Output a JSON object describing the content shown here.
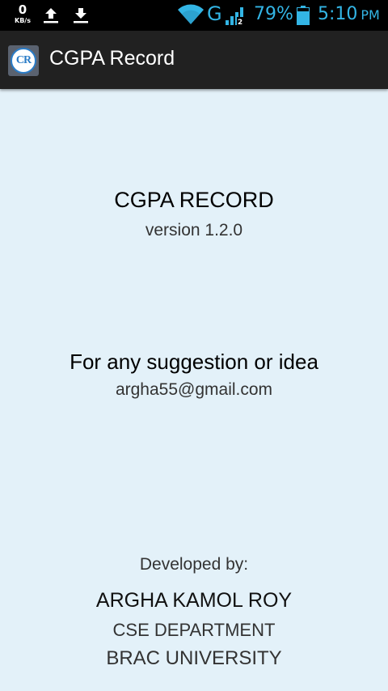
{
  "status_bar": {
    "net_speed_value": "0",
    "net_speed_unit": "KB/s",
    "network_type": "G",
    "signal_sub": "2",
    "battery_percent": "79%",
    "time": "5:10",
    "ampm": "PM",
    "icons": [
      "upload-icon",
      "download-icon",
      "wifi-icon",
      "signal-icon",
      "battery-icon"
    ],
    "accent_color": "#33b5e5"
  },
  "action_bar": {
    "logo_text": "CR",
    "title": "CGPA Record",
    "background": "#212121"
  },
  "content": {
    "app_name": "CGPA RECORD",
    "version": "version 1.2.0",
    "suggestion_heading": "For any suggestion or idea",
    "email": "argha55@gmail.com",
    "developed_by_label": "Developed by:",
    "developer_name": "ARGHA KAMOL ROY",
    "department": "CSE DEPARTMENT",
    "university": "BRAC UNIVERSITY",
    "background": "#e3f1f9"
  }
}
